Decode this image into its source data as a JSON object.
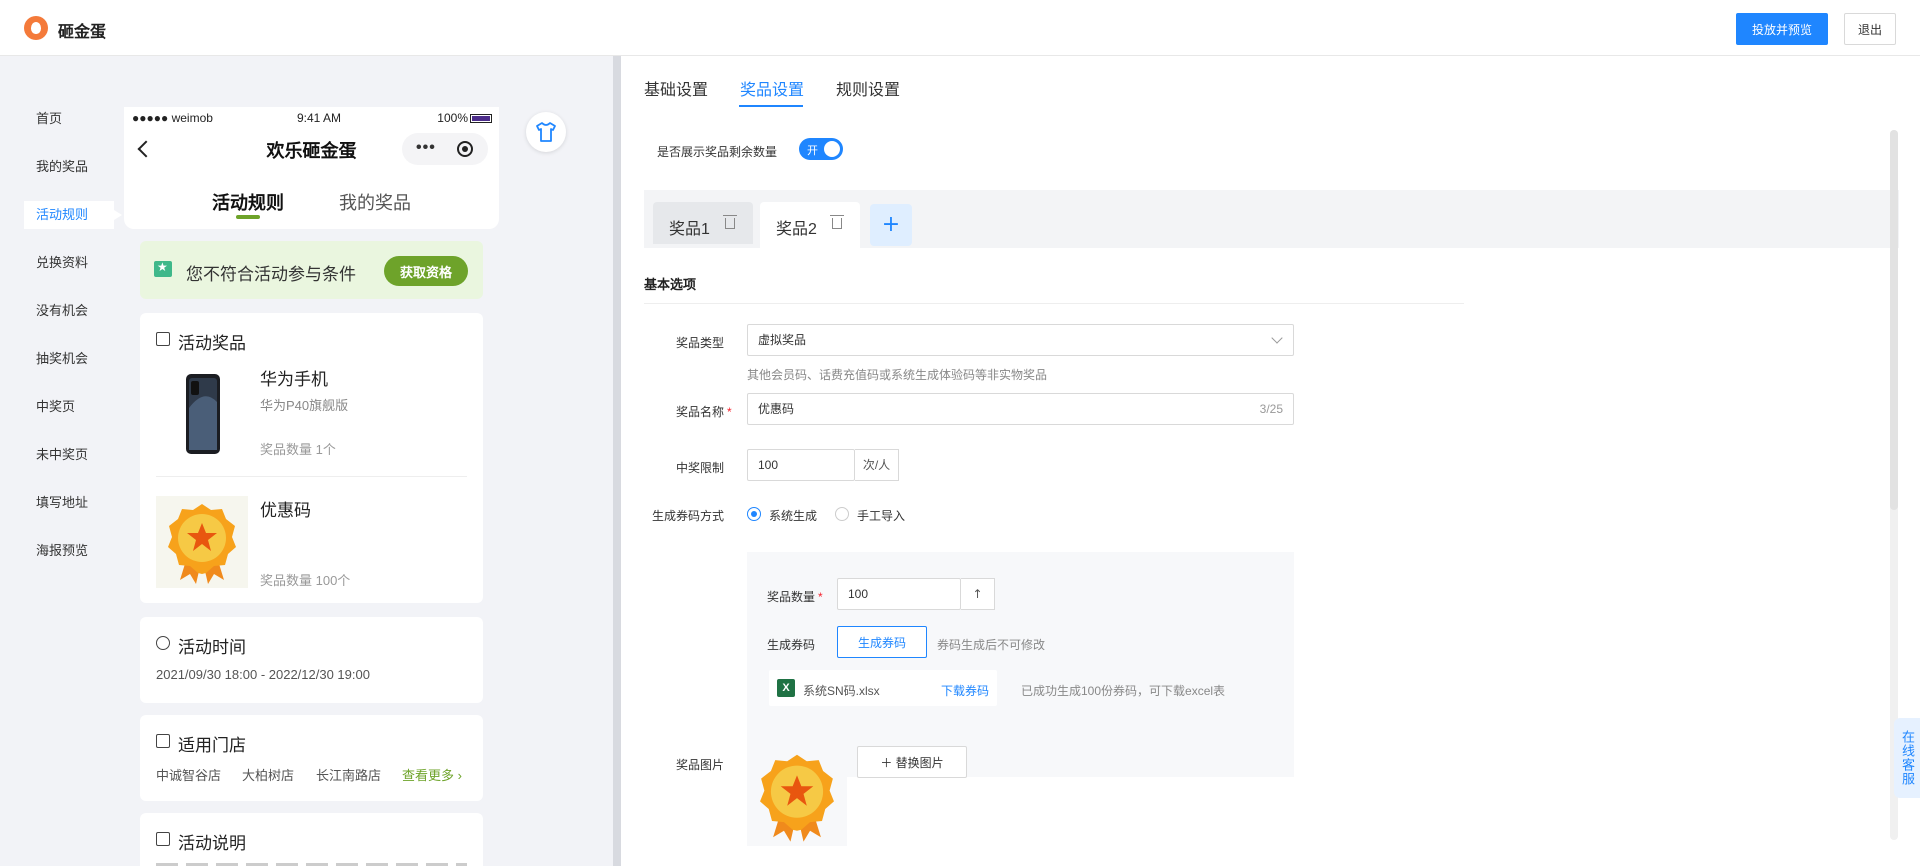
{
  "app": {
    "title": "砸金蛋",
    "publish_label": "投放并预览",
    "exit_label": "退出"
  },
  "leftnav": {
    "items": [
      {
        "label": "首页"
      },
      {
        "label": "我的奖品"
      },
      {
        "label": "活动规则"
      },
      {
        "label": "兑换资料"
      },
      {
        "label": "没有机会"
      },
      {
        "label": "抽奖机会"
      },
      {
        "label": "中奖页"
      },
      {
        "label": "未中奖页"
      },
      {
        "label": "填写地址"
      },
      {
        "label": "海报预览"
      }
    ],
    "active_index": 2
  },
  "phone": {
    "carrier": "●●●●● weimob",
    "time": "9:41 AM",
    "battery": "100%",
    "title": "欢乐砸金蛋",
    "tabs": [
      {
        "label": "活动规则"
      },
      {
        "label": "我的奖品"
      }
    ],
    "notice": {
      "text": "您不符合活动参与条件",
      "button": "获取资格"
    },
    "prizes_card": {
      "title": "活动奖品",
      "items": [
        {
          "name": "华为手机",
          "sub": "华为P40旗舰版",
          "qty": "奖品数量  1个"
        },
        {
          "name": "优惠码",
          "sub": "",
          "qty": "奖品数量  100个"
        }
      ]
    },
    "time_card": {
      "title": "活动时间",
      "value": "2021/09/30 18:00 - 2022/12/30 19:00"
    },
    "store_card": {
      "title": "适用门店",
      "stores": [
        "中诚智谷店",
        "大柏树店",
        "长江南路店"
      ],
      "more": "查看更多"
    },
    "desc_card": {
      "title": "活动说明"
    }
  },
  "panel": {
    "tabs": [
      {
        "label": "基础设置"
      },
      {
        "label": "奖品设置"
      },
      {
        "label": "规则设置"
      }
    ],
    "active_tab": 1,
    "show_remaining_label": "是否展示奖品剩余数量",
    "show_remaining_toggle": "开",
    "prize_tabs": [
      {
        "label": "奖品1"
      },
      {
        "label": "奖品2"
      }
    ],
    "add_icon": "plus-icon",
    "section_title": "基本选项",
    "prize_type": {
      "label": "奖品类型",
      "value": "虚拟奖品",
      "hint": "其他会员码、话费充值码或系统生成体验码等非实物奖品"
    },
    "prize_name": {
      "label": "奖品名称",
      "value": "优惠码",
      "counter": "3/25"
    },
    "win_limit": {
      "label": "中奖限制",
      "value": "100",
      "unit": "次/人"
    },
    "code_method": {
      "label": "生成券码方式",
      "options": [
        {
          "label": "系统生成",
          "checked": true
        },
        {
          "label": "手工导入",
          "checked": false
        }
      ]
    },
    "prize_qty": {
      "label": "奖品数量",
      "value": "100"
    },
    "gen_code": {
      "label": "生成券码",
      "button": "生成券码",
      "hint": "券码生成后不可修改"
    },
    "file": {
      "name": "系统SN码.xlsx",
      "download": "下载券码",
      "status": "已成功生成100份券码，可下载excel表"
    },
    "prize_image": {
      "label": "奖品图片",
      "replace": "替换图片"
    }
  },
  "service_label": "在线客服",
  "colors": {
    "accent": "#1f86ff",
    "phone_green": "#6ea32a",
    "brand": "#f47a3a"
  }
}
